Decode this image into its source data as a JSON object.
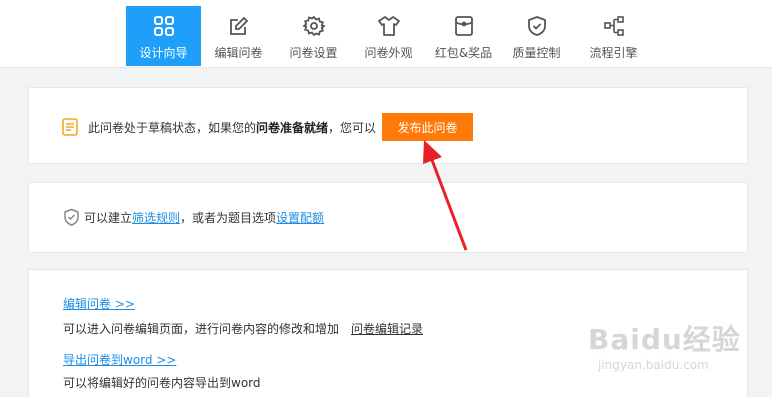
{
  "nav": {
    "tabs": [
      {
        "label": "设计向导",
        "icon": "grid-icon",
        "active": true
      },
      {
        "label": "编辑问卷",
        "icon": "edit-icon",
        "active": false
      },
      {
        "label": "问卷设置",
        "icon": "gear-icon",
        "active": false
      },
      {
        "label": "问卷外观",
        "icon": "shirt-icon",
        "active": false
      },
      {
        "label": "红包&奖品",
        "icon": "redpacket-icon",
        "active": false
      },
      {
        "label": "质量控制",
        "icon": "shield-check-icon",
        "active": false
      },
      {
        "label": "流程引擎",
        "icon": "flow-icon",
        "active": false
      }
    ],
    "active_color": "#1ea0fa"
  },
  "draft_notice": {
    "icon": "document-icon",
    "text_before": "此问卷处于草稿状态，如果您的",
    "text_bold": "问卷准备就绪",
    "text_after": "，您可以",
    "publish_button": "发布此问卷",
    "button_color": "#ff7a0a"
  },
  "filter_notice": {
    "icon": "shield-icon",
    "text1": "可以建立",
    "link1": "筛选规则",
    "text2": "，或者为题目选项",
    "link2": "设置配额"
  },
  "actions": {
    "edit_link": "编辑问卷 >>",
    "edit_desc": "可以进入问卷编辑页面，进行问卷内容的修改和增加",
    "edit_record_link": "问卷编辑记录",
    "export_link": "导出问卷到word >>",
    "export_desc": "可以将编辑好的问卷内容导出到word"
  },
  "watermark": {
    "main": "Baidu经验",
    "sub": "jingyan.baidu.com"
  },
  "annotation": {
    "arrow_color": "#e8202a"
  }
}
